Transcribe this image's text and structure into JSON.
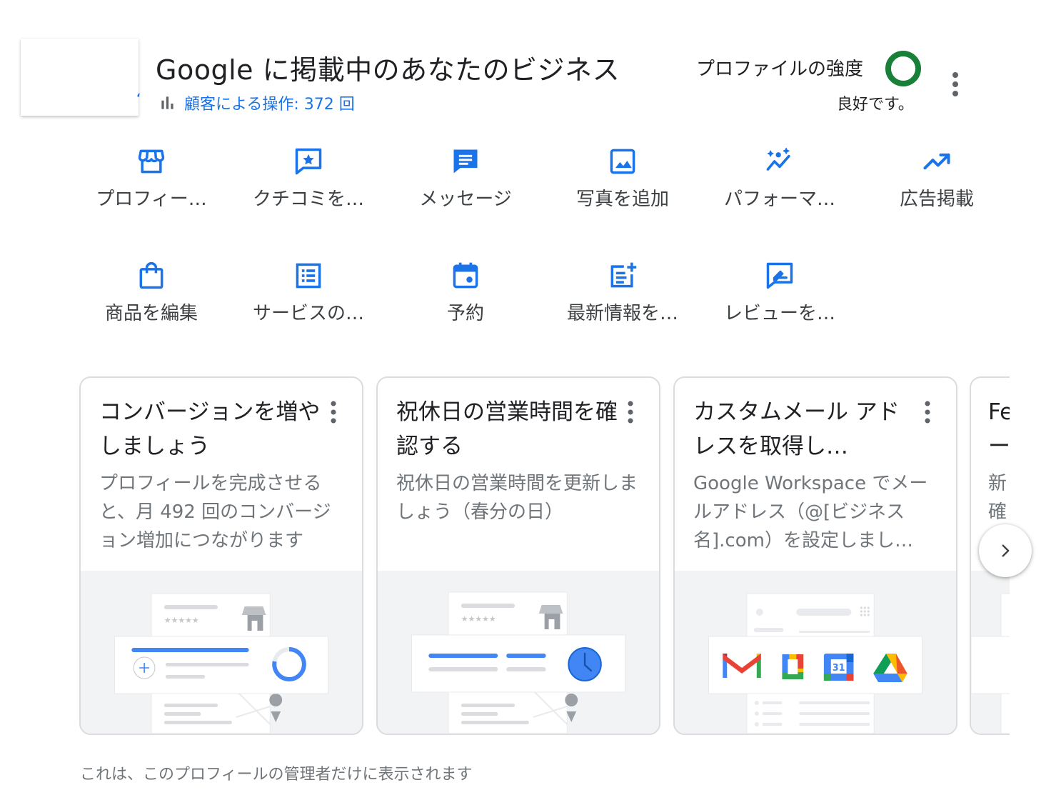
{
  "header": {
    "title": "Google に掲載中のあなたのビジネス",
    "customer_actions": "顧客による操作: 372 回",
    "profile_strength_label": "プロファイルの強度",
    "profile_strength_status": "良好です。",
    "strength_color": "#188038"
  },
  "accent_color": "#1a73e8",
  "actions": [
    {
      "label": "プロフィー…",
      "icon": "storefront-icon"
    },
    {
      "label": "クチコミを…",
      "icon": "review-star-icon"
    },
    {
      "label": "メッセージ",
      "icon": "message-icon"
    },
    {
      "label": "写真を追加",
      "icon": "photo-icon"
    },
    {
      "label": "パフォーマ…",
      "icon": "performance-icon"
    },
    {
      "label": "広告掲載",
      "icon": "trending-up-icon"
    },
    {
      "label": "商品を編集",
      "icon": "shopping-bag-icon"
    },
    {
      "label": "サービスの…",
      "icon": "list-icon"
    },
    {
      "label": "予約",
      "icon": "calendar-icon"
    },
    {
      "label": "最新情報を…",
      "icon": "post-add-icon"
    },
    {
      "label": "レビューを…",
      "icon": "rate-review-icon"
    }
  ],
  "cards": [
    {
      "title": "コンバージョンを増やしましょう",
      "body": "プロフィールを完成させると、月 492 回のコンバージョン増加につながります"
    },
    {
      "title": "祝休日の営業時間を確認する",
      "body": "祝休日の営業時間を更新しましょう（春分の日）"
    },
    {
      "title": "カスタムメール アドレスを取得し…",
      "body": "Google Workspace でメールアドレス（@[ビジネス名].com）を設定しまし…"
    }
  ],
  "partial_card": {
    "title_lines": [
      "Fe",
      "ー"
    ],
    "body_lines": [
      "新",
      "確"
    ]
  },
  "footer": "これは、このプロフィールの管理者だけに表示されます"
}
